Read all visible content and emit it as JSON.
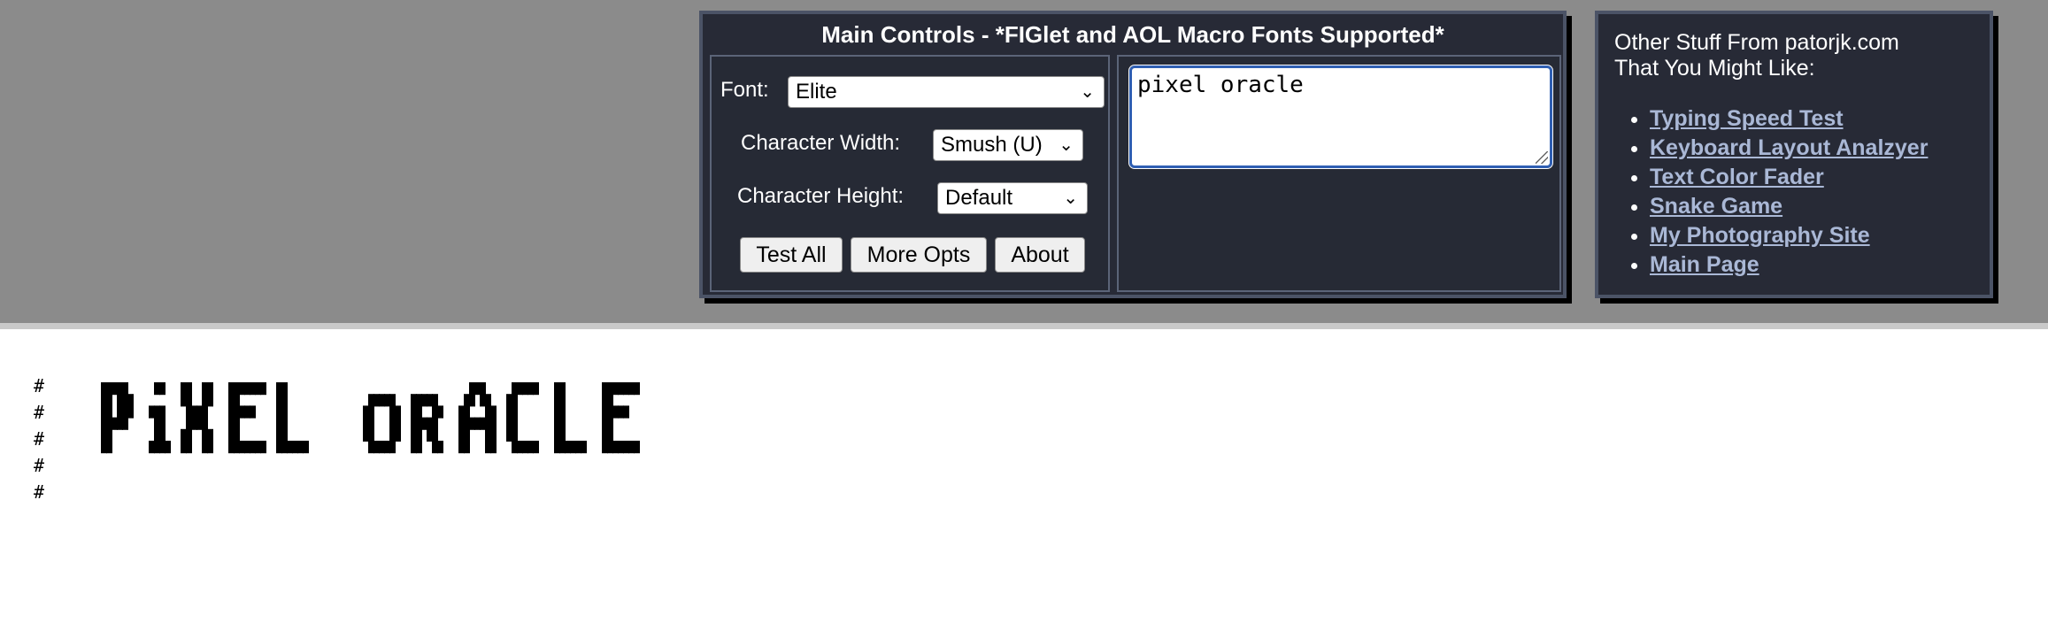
{
  "main_controls": {
    "title": "Main Controls - *FIGlet and AOL Macro Fonts Supported*",
    "font_label": "Font:",
    "font_value": "Elite",
    "width_label": "Character Width:",
    "width_value": "Smush (U)",
    "height_label": "Character Height:",
    "height_value": "Default",
    "buttons": {
      "test_all": "Test All",
      "more_opts": "More Opts",
      "about": "About"
    },
    "text_value": "pixel oracle"
  },
  "other_stuff": {
    "intro_line1": "Other Stuff From patorjk.com",
    "intro_line2": "That You Might Like:",
    "links": [
      "Typing Speed Test",
      "Keyboard Layout Analzyer",
      "Text Color Fader",
      "Snake Game",
      "My Photography Site",
      "Main Page"
    ]
  },
  "output": {
    "hash_char": "#",
    "rendered_text": "pixel oracle"
  },
  "colors": {
    "band": "#8b8b8b",
    "panel": "#272a36",
    "link": "#aab8d6",
    "input_focus": "#2f5fb3"
  }
}
